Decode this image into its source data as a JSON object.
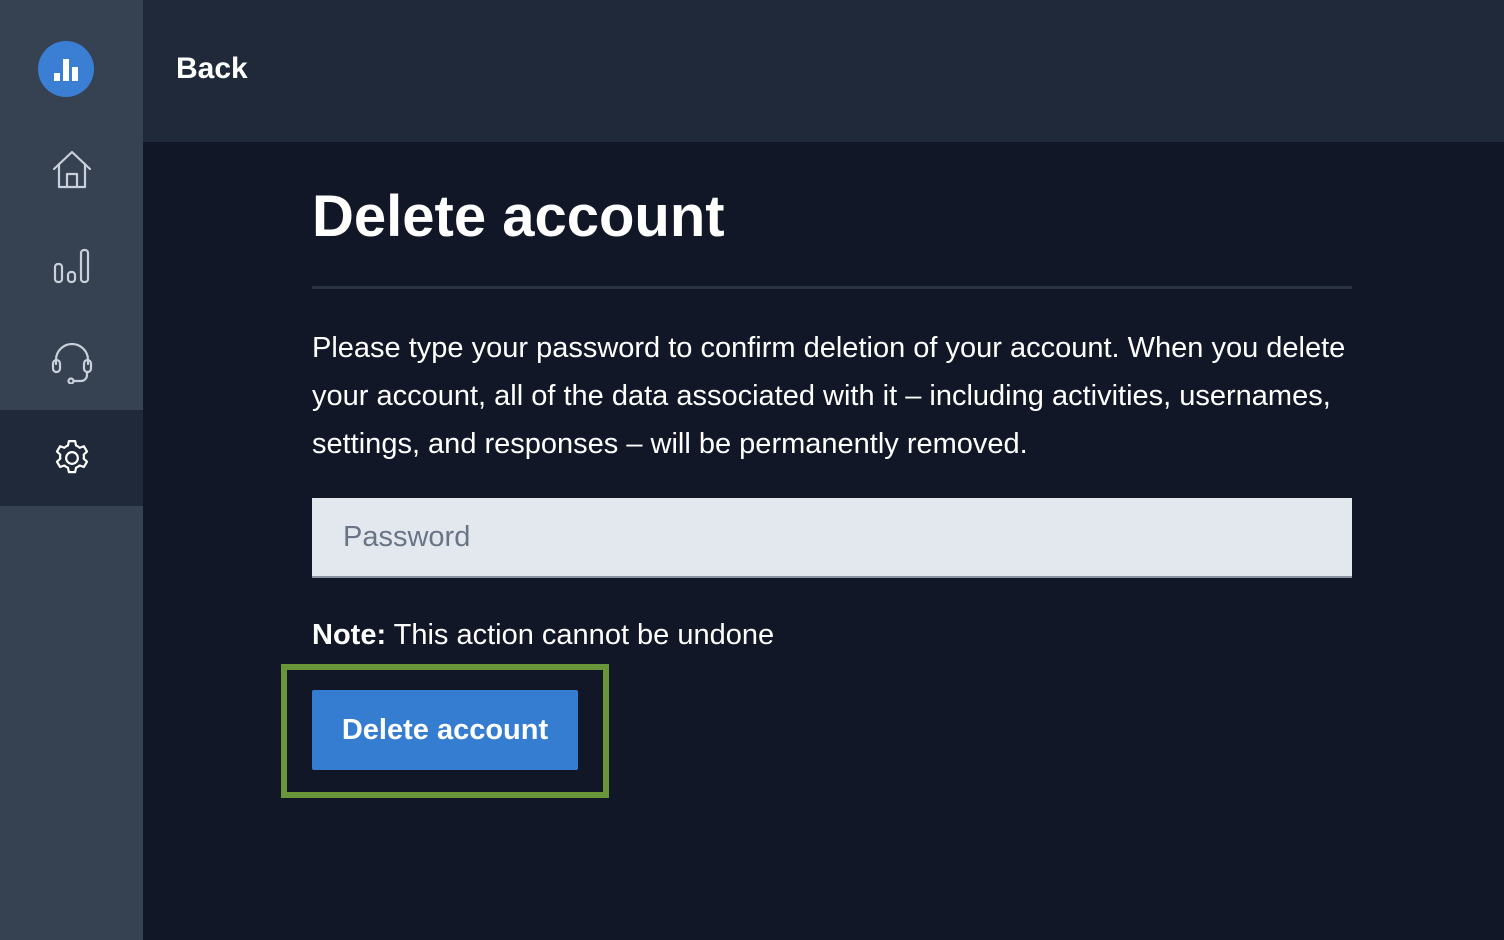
{
  "header": {
    "back_label": "Back"
  },
  "sidebar": {
    "logo_icon": "bar-chart-logo-icon",
    "items": [
      {
        "icon": "home-icon",
        "active": false
      },
      {
        "icon": "bar-chart-icon",
        "active": false
      },
      {
        "icon": "headset-icon",
        "active": false
      },
      {
        "icon": "gear-icon",
        "active": true
      }
    ]
  },
  "main": {
    "title": "Delete account",
    "description": "Please type your password to confirm deletion of your account. When you delete your account, all of the data associated with it – including activities, usernames, settings, and responses – will be permanently removed.",
    "password": {
      "placeholder": "Password",
      "value": ""
    },
    "note_label": "Note:",
    "note_text": " This action cannot be undone",
    "delete_button_label": "Delete account"
  },
  "colors": {
    "sidebar_bg": "#364152",
    "header_bg": "#202939",
    "main_bg": "#111727",
    "accent": "#357dd0",
    "highlight": "#6a963a",
    "input_bg": "#e3e8ef"
  }
}
